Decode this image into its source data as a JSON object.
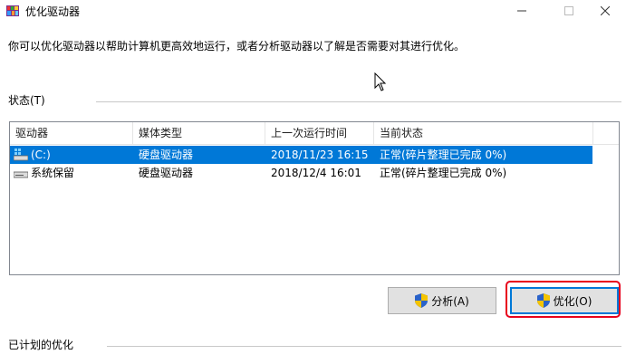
{
  "window": {
    "title": "优化驱动器",
    "icons": {
      "app": "defrag-app-icon",
      "minimize": "minimize-icon",
      "maximize": "maximize-icon",
      "close": "close-icon"
    }
  },
  "description": "你可以优化驱动器以帮助计算机更高效地运行，或者分析驱动器以了解是否需要对其进行优化。",
  "status_group": {
    "label": "状态(T)",
    "columns": [
      "驱动器",
      "媒体类型",
      "上一次运行时间",
      "当前状态"
    ],
    "rows": [
      {
        "drive": "(C:)",
        "media": "硬盘驱动器",
        "last_run": "2018/11/23 16:15",
        "status": "正常(碎片整理已完成 0%)",
        "selected": true,
        "icon": "windows-drive-icon"
      },
      {
        "drive": "系统保留",
        "media": "硬盘驱动器",
        "last_run": "2018/12/4 16:01",
        "status": "正常(碎片整理已完成 0%)",
        "selected": false,
        "icon": "hard-drive-icon"
      }
    ]
  },
  "buttons": {
    "analyze": "分析(A)",
    "optimize": "优化(O)",
    "icon": "uac-shield-icon"
  },
  "scheduled_group": {
    "label": "已计划的优化"
  },
  "colors": {
    "selection": "#0078d7",
    "highlight": "#e8001c",
    "button_face": "#e1e1e1"
  }
}
